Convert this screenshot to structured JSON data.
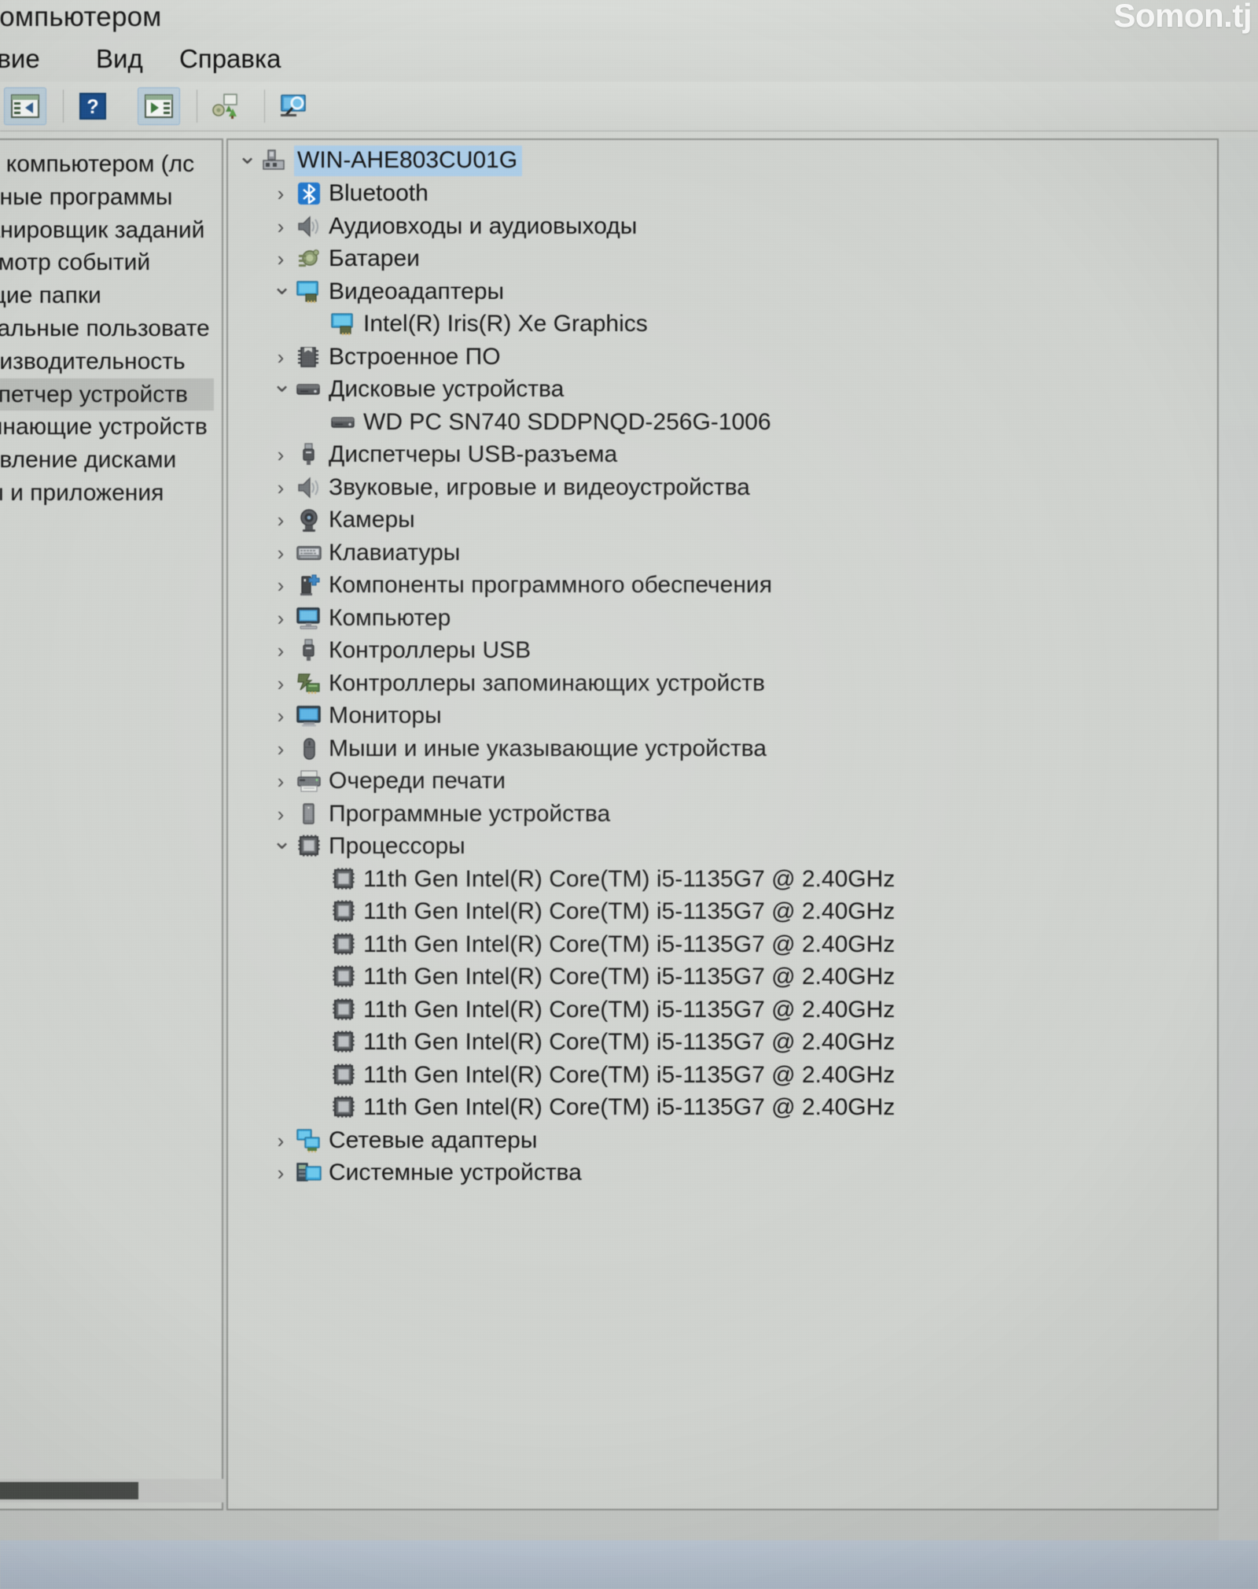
{
  "window": {
    "title": "ие компьютером",
    "watermark": "Somon.tj"
  },
  "menu": {
    "items": [
      {
        "label": "тствие",
        "name": "menu-action"
      },
      {
        "label": "Вид",
        "name": "menu-view"
      },
      {
        "label": "Справка",
        "name": "menu-help"
      }
    ]
  },
  "toolbar": {
    "buttons": [
      {
        "name": "back-navigation-button",
        "icon": "panel-back-icon",
        "active": true
      },
      {
        "name": "help-button",
        "icon": "question-mark-icon",
        "active": false
      },
      {
        "name": "show-hide-console-tree-button",
        "icon": "panel-forward-icon",
        "active": true
      },
      {
        "name": "scan-for-hardware-changes-button",
        "icon": "gear-tree-icon",
        "active": false
      },
      {
        "name": "properties-button",
        "icon": "monitor-magnifier-icon",
        "active": false
      }
    ]
  },
  "sidebar": {
    "items": [
      {
        "label": "ие компьютером (лс",
        "name": "sidebar-item-computer-management",
        "selected": false
      },
      {
        "label": "ебные программы",
        "name": "sidebar-item-system-tools",
        "selected": false
      },
      {
        "label": "ланировщик заданий",
        "name": "sidebar-item-task-scheduler",
        "selected": false
      },
      {
        "label": "осмотр событий",
        "name": "sidebar-item-event-viewer",
        "selected": false
      },
      {
        "label": "бщие папки",
        "name": "sidebar-item-shared-folders",
        "selected": false
      },
      {
        "label": "окальные пользовате",
        "name": "sidebar-item-local-users-groups",
        "selected": false
      },
      {
        "label": "роизводительность",
        "name": "sidebar-item-performance",
        "selected": false
      },
      {
        "label": "испетчер устройств",
        "name": "sidebar-item-device-manager",
        "selected": true
      },
      {
        "label": "минающие устройств",
        "name": "sidebar-item-storage",
        "selected": false
      },
      {
        "label": "равление дисками",
        "name": "sidebar-item-disk-management",
        "selected": false
      },
      {
        "label": "бы и приложения",
        "name": "sidebar-item-services-applications",
        "selected": false
      }
    ]
  },
  "tree": {
    "nodes": [
      {
        "label": "WIN-AHE803CU01G",
        "depth": 0,
        "expander": "down",
        "icon": "computer-root-icon",
        "selected": true,
        "name": "tree-node-root"
      },
      {
        "label": "Bluetooth",
        "depth": 1,
        "expander": "right",
        "icon": "bluetooth-icon",
        "selected": false,
        "name": "tree-node-bluetooth"
      },
      {
        "label": "Аудиовходы и аудиовыходы",
        "depth": 1,
        "expander": "right",
        "icon": "speaker-icon",
        "selected": false,
        "name": "tree-node-audio-io"
      },
      {
        "label": "Батареи",
        "depth": 1,
        "expander": "right",
        "icon": "battery-icon",
        "selected": false,
        "name": "tree-node-batteries"
      },
      {
        "label": "Видеоадаптеры",
        "depth": 1,
        "expander": "down",
        "icon": "display-adapter-icon",
        "selected": false,
        "name": "tree-node-display-adapters"
      },
      {
        "label": "Intel(R) Iris(R) Xe Graphics",
        "depth": 2,
        "expander": "none",
        "icon": "display-adapter-icon",
        "selected": false,
        "name": "tree-node-intel-iris-xe"
      },
      {
        "label": "Встроенное ПО",
        "depth": 1,
        "expander": "right",
        "icon": "firmware-chip-icon",
        "selected": false,
        "name": "tree-node-firmware"
      },
      {
        "label": "Дисковые устройства",
        "depth": 1,
        "expander": "down",
        "icon": "disk-drive-icon",
        "selected": false,
        "name": "tree-node-disk-drives"
      },
      {
        "label": "WD PC SN740 SDDPNQD-256G-1006",
        "depth": 2,
        "expander": "none",
        "icon": "disk-drive-icon",
        "selected": false,
        "name": "tree-node-wd-sn740"
      },
      {
        "label": "Диспетчеры USB-разъема",
        "depth": 1,
        "expander": "right",
        "icon": "usb-connector-icon",
        "selected": false,
        "name": "tree-node-usb-connector-managers"
      },
      {
        "label": "Звуковые, игровые и видеоустройства",
        "depth": 1,
        "expander": "right",
        "icon": "speaker-icon",
        "selected": false,
        "name": "tree-node-sound-video-game"
      },
      {
        "label": "Камеры",
        "depth": 1,
        "expander": "right",
        "icon": "camera-icon",
        "selected": false,
        "name": "tree-node-cameras"
      },
      {
        "label": "Клавиатуры",
        "depth": 1,
        "expander": "right",
        "icon": "keyboard-icon",
        "selected": false,
        "name": "tree-node-keyboards"
      },
      {
        "label": "Компоненты программного обеспечения",
        "depth": 1,
        "expander": "right",
        "icon": "software-component-icon",
        "selected": false,
        "name": "tree-node-software-components"
      },
      {
        "label": "Компьютер",
        "depth": 1,
        "expander": "right",
        "icon": "computer-icon",
        "selected": false,
        "name": "tree-node-computer"
      },
      {
        "label": "Контроллеры USB",
        "depth": 1,
        "expander": "right",
        "icon": "usb-connector-icon",
        "selected": false,
        "name": "tree-node-usb-controllers"
      },
      {
        "label": "Контроллеры запоминающих устройств",
        "depth": 1,
        "expander": "right",
        "icon": "storage-controller-icon",
        "selected": false,
        "name": "tree-node-storage-controllers"
      },
      {
        "label": "Мониторы",
        "depth": 1,
        "expander": "right",
        "icon": "monitor-icon",
        "selected": false,
        "name": "tree-node-monitors"
      },
      {
        "label": "Мыши и иные указывающие устройства",
        "depth": 1,
        "expander": "right",
        "icon": "mouse-icon",
        "selected": false,
        "name": "tree-node-mice"
      },
      {
        "label": "Очереди печати",
        "depth": 1,
        "expander": "right",
        "icon": "printer-icon",
        "selected": false,
        "name": "tree-node-print-queues"
      },
      {
        "label": "Программные устройства",
        "depth": 1,
        "expander": "right",
        "icon": "software-device-icon",
        "selected": false,
        "name": "tree-node-software-devices"
      },
      {
        "label": "Процессоры",
        "depth": 1,
        "expander": "down",
        "icon": "cpu-icon",
        "selected": false,
        "name": "tree-node-processors"
      },
      {
        "label": "11th Gen Intel(R) Core(TM) i5-1135G7 @ 2.40GHz",
        "depth": 2,
        "expander": "none",
        "icon": "cpu-icon",
        "selected": false,
        "name": "tree-node-cpu-core-0"
      },
      {
        "label": "11th Gen Intel(R) Core(TM) i5-1135G7 @ 2.40GHz",
        "depth": 2,
        "expander": "none",
        "icon": "cpu-icon",
        "selected": false,
        "name": "tree-node-cpu-core-1"
      },
      {
        "label": "11th Gen Intel(R) Core(TM) i5-1135G7 @ 2.40GHz",
        "depth": 2,
        "expander": "none",
        "icon": "cpu-icon",
        "selected": false,
        "name": "tree-node-cpu-core-2"
      },
      {
        "label": "11th Gen Intel(R) Core(TM) i5-1135G7 @ 2.40GHz",
        "depth": 2,
        "expander": "none",
        "icon": "cpu-icon",
        "selected": false,
        "name": "tree-node-cpu-core-3"
      },
      {
        "label": "11th Gen Intel(R) Core(TM) i5-1135G7 @ 2.40GHz",
        "depth": 2,
        "expander": "none",
        "icon": "cpu-icon",
        "selected": false,
        "name": "tree-node-cpu-core-4"
      },
      {
        "label": "11th Gen Intel(R) Core(TM) i5-1135G7 @ 2.40GHz",
        "depth": 2,
        "expander": "none",
        "icon": "cpu-icon",
        "selected": false,
        "name": "tree-node-cpu-core-5"
      },
      {
        "label": "11th Gen Intel(R) Core(TM) i5-1135G7 @ 2.40GHz",
        "depth": 2,
        "expander": "none",
        "icon": "cpu-icon",
        "selected": false,
        "name": "tree-node-cpu-core-6"
      },
      {
        "label": "11th Gen Intel(R) Core(TM) i5-1135G7 @ 2.40GHz",
        "depth": 2,
        "expander": "none",
        "icon": "cpu-icon",
        "selected": false,
        "name": "tree-node-cpu-core-7"
      },
      {
        "label": "Сетевые адаптеры",
        "depth": 1,
        "expander": "right",
        "icon": "network-adapter-icon",
        "selected": false,
        "name": "tree-node-network-adapters"
      },
      {
        "label": "Системные устройства",
        "depth": 1,
        "expander": "right",
        "icon": "system-device-icon",
        "selected": false,
        "name": "tree-node-system-devices"
      }
    ]
  },
  "colors": {
    "selection_blue": "#a8cbe8",
    "sidebar_selection": "#b6b9b5",
    "window_bg": "#cdd0cc",
    "text": "#141414",
    "bluetooth_blue": "#1c76d2",
    "icon_blue": "#3b9bd8"
  }
}
